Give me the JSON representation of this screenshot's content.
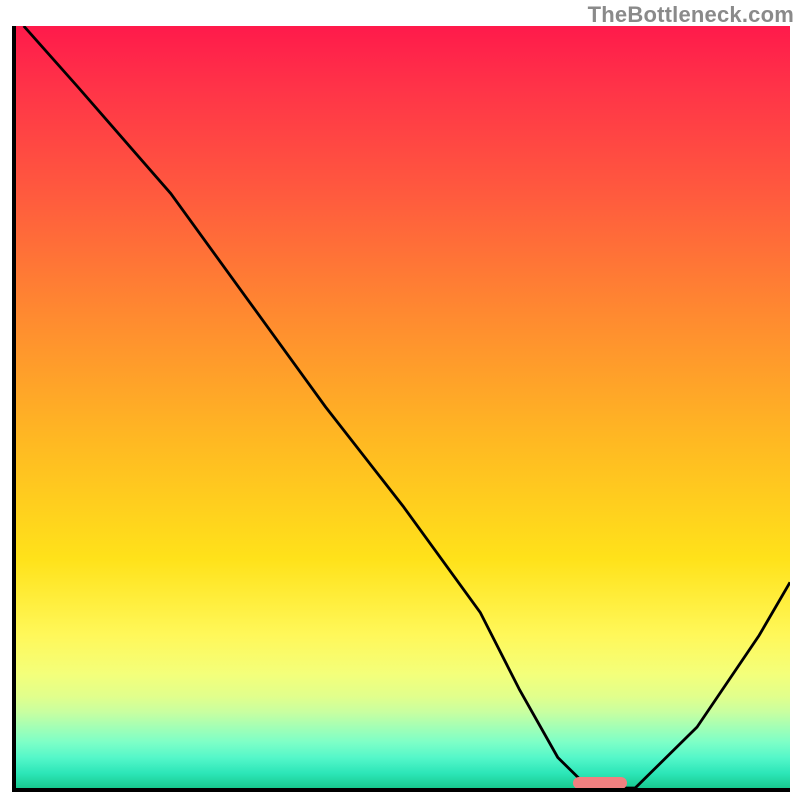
{
  "attribution": "TheBottleneck.com",
  "chart_data": {
    "type": "line",
    "title": "",
    "xlabel": "",
    "ylabel": "",
    "xlim": [
      0,
      100
    ],
    "ylim": [
      0,
      100
    ],
    "grid": false,
    "series": [
      {
        "name": "bottleneck-curve",
        "x": [
          1,
          8,
          20,
          30,
          40,
          50,
          60,
          65,
          70,
          74,
          80,
          88,
          96,
          100
        ],
        "y": [
          100,
          92,
          78,
          64,
          50,
          37,
          23,
          13,
          4,
          0,
          0,
          8,
          20,
          27
        ]
      }
    ],
    "marker": {
      "x_start": 72,
      "x_end": 79,
      "y": 0.6,
      "color": "#f08080"
    },
    "gradient_stops": [
      {
        "pct": 0,
        "color": "#ff1a4b"
      },
      {
        "pct": 22,
        "color": "#ff5a3e"
      },
      {
        "pct": 55,
        "color": "#ffba22"
      },
      {
        "pct": 80,
        "color": "#fff85a"
      },
      {
        "pct": 92,
        "color": "#a3ffb5"
      },
      {
        "pct": 100,
        "color": "#18c98f"
      }
    ]
  }
}
